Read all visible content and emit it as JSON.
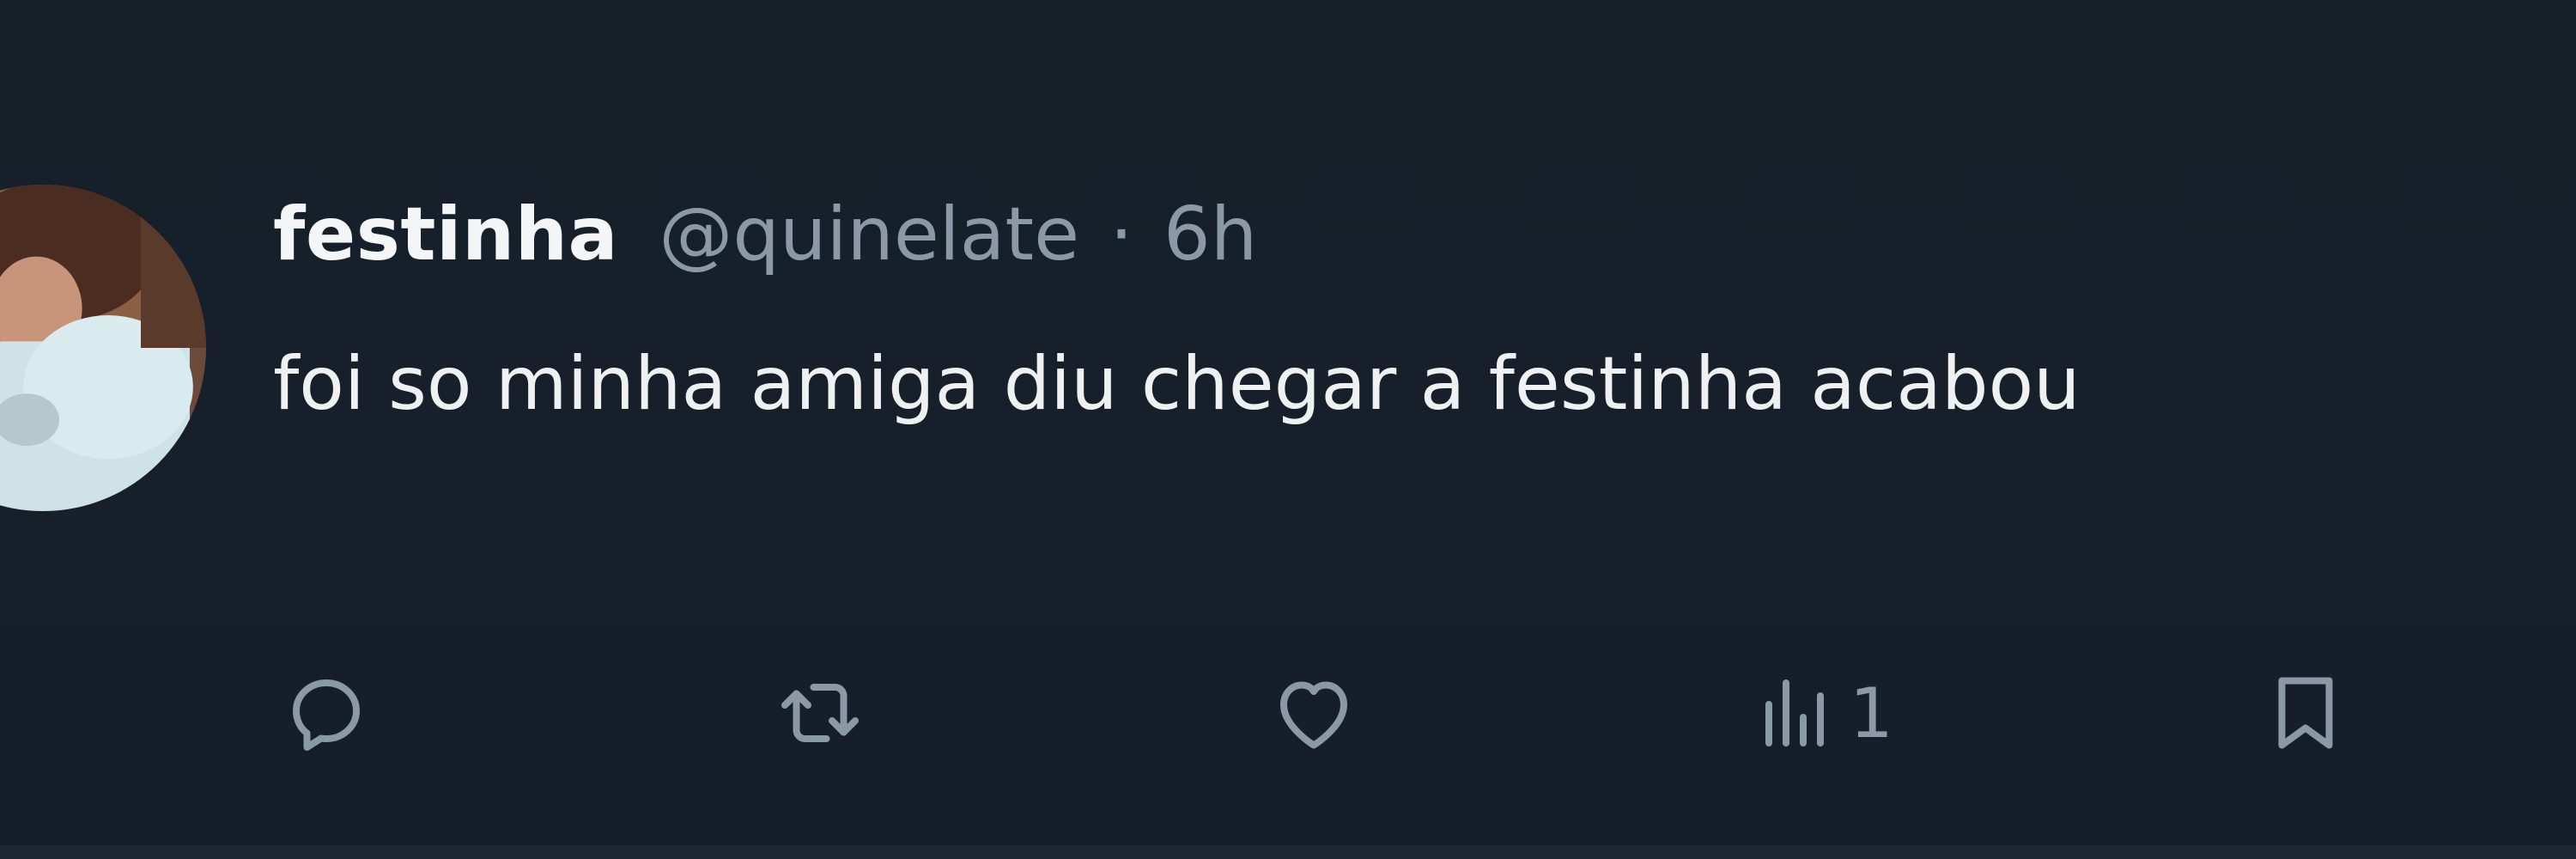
{
  "tweet": {
    "display_name": "festinha",
    "handle": "@quinelate",
    "separator": "·",
    "time": "6h",
    "text": "foi so minha amiga diu chegar a festinha acabou"
  },
  "actions": {
    "reply": {
      "icon": "reply-icon"
    },
    "retweet": {
      "icon": "retweet-icon"
    },
    "like": {
      "icon": "heart-icon"
    },
    "views": {
      "icon": "analytics-icon",
      "count": "1"
    },
    "bookmark": {
      "icon": "bookmark-icon"
    }
  },
  "colors": {
    "background": "#16202b",
    "primary_text": "#e7e9ea",
    "secondary_text": "#8b98a5"
  }
}
